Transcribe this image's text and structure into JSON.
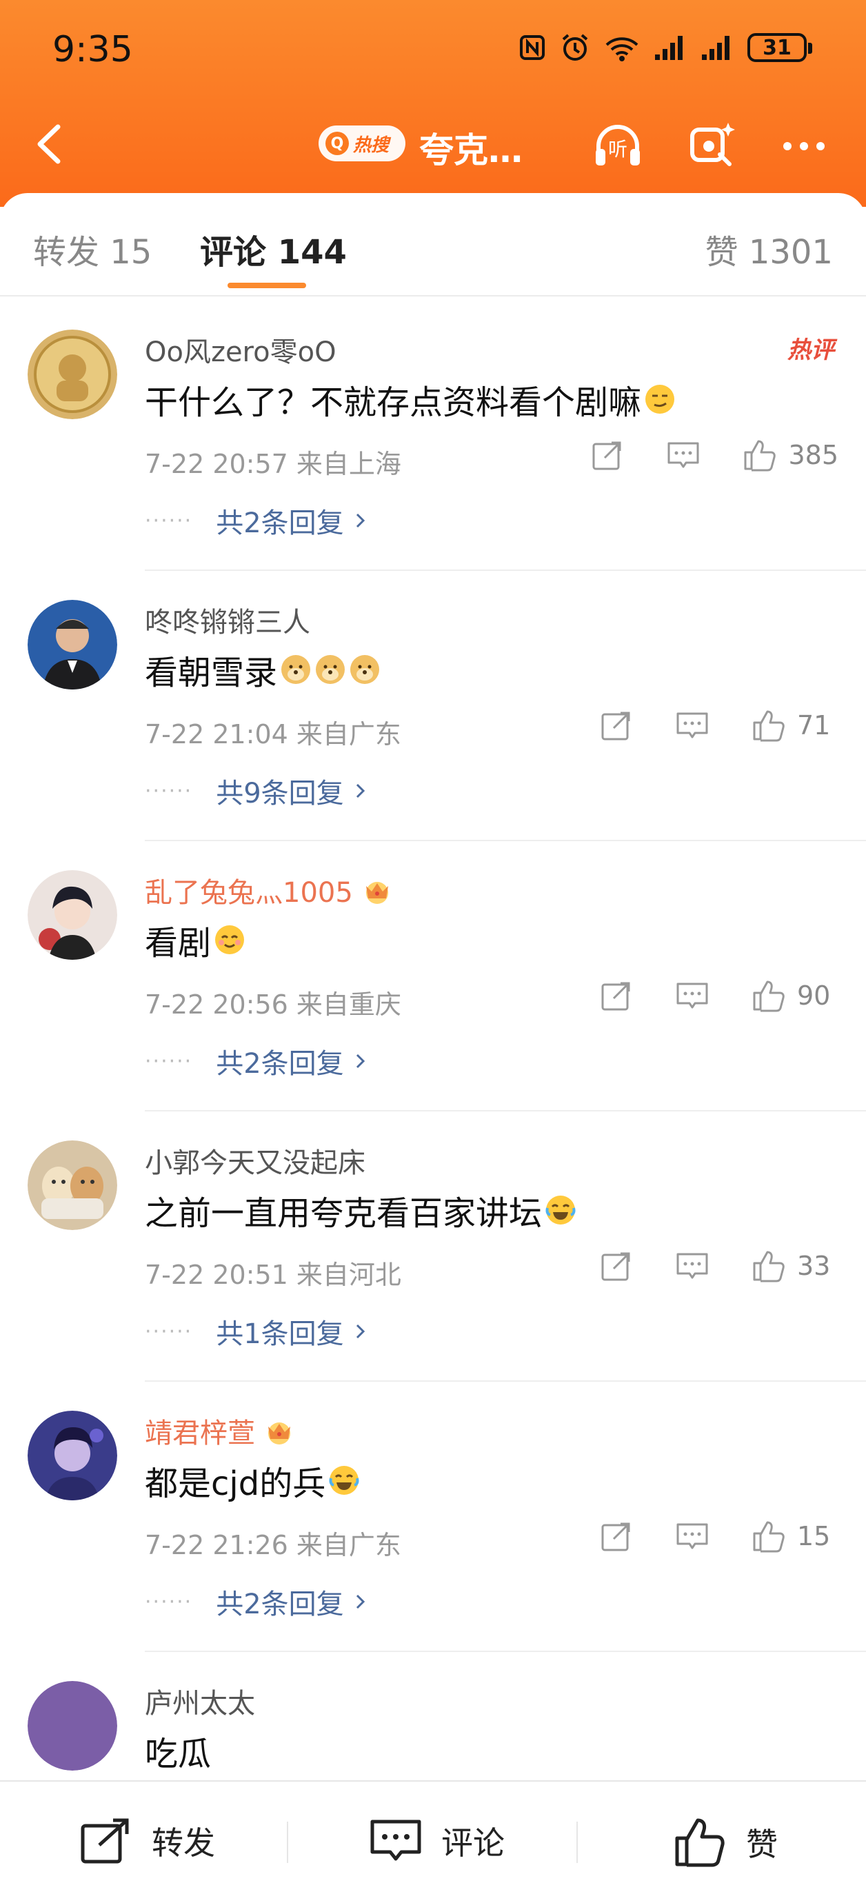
{
  "status": {
    "time": "9:35",
    "battery": "31"
  },
  "nav": {
    "hot_label": "热搜",
    "title": "夸克…"
  },
  "tabs": [
    {
      "label": "转发 15"
    },
    {
      "label": "评论 144"
    },
    {
      "label": "赞 1301"
    }
  ],
  "comments": [
    {
      "username": "Oo风zero零oO",
      "vip": false,
      "hot_tag": "热评",
      "text": "干什么了？不就存点资料看个剧嘛",
      "emoji": "smirk-face",
      "emoji_count": 1,
      "meta": "7-22 20:57  来自上海",
      "likes": "385",
      "replies": "共2条回复",
      "avatar_color": "#d9b36a"
    },
    {
      "username": "咚咚锵锵三人",
      "vip": false,
      "hot_tag": "",
      "text": "看朝雪录",
      "emoji": "doge-face",
      "emoji_count": 3,
      "meta": "7-22 21:04  来自广东",
      "likes": "71",
      "replies": "共9条回复",
      "avatar_color": "#2a5ea8"
    },
    {
      "username": "乱了兔兔灬1005",
      "vip": true,
      "hot_tag": "",
      "text": "看剧",
      "emoji": "smile-face",
      "emoji_count": 1,
      "meta": "7-22 20:56  来自重庆",
      "likes": "90",
      "replies": "共2条回复",
      "avatar_color": "#e8d6d2"
    },
    {
      "username": "小郭今天又没起床",
      "vip": false,
      "hot_tag": "",
      "text": "之前一直用夸克看百家讲坛",
      "emoji": "laugh-tears-face",
      "emoji_count": 1,
      "meta": "7-22 20:51  来自河北",
      "likes": "33",
      "replies": "共1条回复",
      "avatar_color": "#c9a77a"
    },
    {
      "username": "靖君梓萱",
      "vip": true,
      "hot_tag": "",
      "text": "都是cjd的兵",
      "emoji": "laugh-tears-face",
      "emoji_count": 1,
      "meta": "7-22 21:26  来自广东",
      "likes": "15",
      "replies": "共2条回复",
      "avatar_color": "#3a3c8a"
    },
    {
      "username": "庐州太太",
      "vip": false,
      "hot_tag": "",
      "text": "吃瓜",
      "emoji": "",
      "emoji_count": 0,
      "meta": "",
      "likes": "",
      "replies": "",
      "avatar_color": "#7b5ea7"
    }
  ],
  "bottom_bar": {
    "repost": "转发",
    "comment": "评论",
    "like": "赞"
  },
  "colors": {
    "header": "#fb7a24",
    "accent": "#fb8a2e",
    "vip_name": "#eb7350",
    "reply_link": "#4b6a9c"
  }
}
